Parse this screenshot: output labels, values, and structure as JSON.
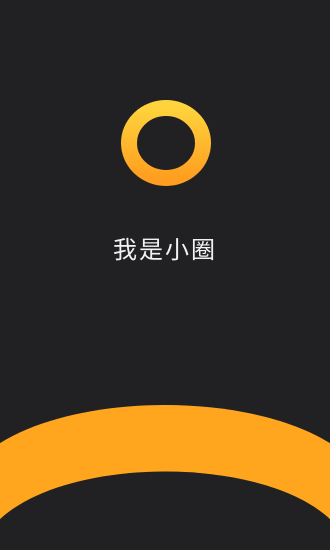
{
  "splash": {
    "tagline": "我是小圈"
  },
  "logo": {
    "icon": "ring-logo-icon"
  },
  "colors": {
    "background": "#212124",
    "accent_top": "#ffd33d",
    "accent_bottom": "#ff9e1f",
    "arc": "#ffa51e",
    "text": "#f2f2f2"
  }
}
